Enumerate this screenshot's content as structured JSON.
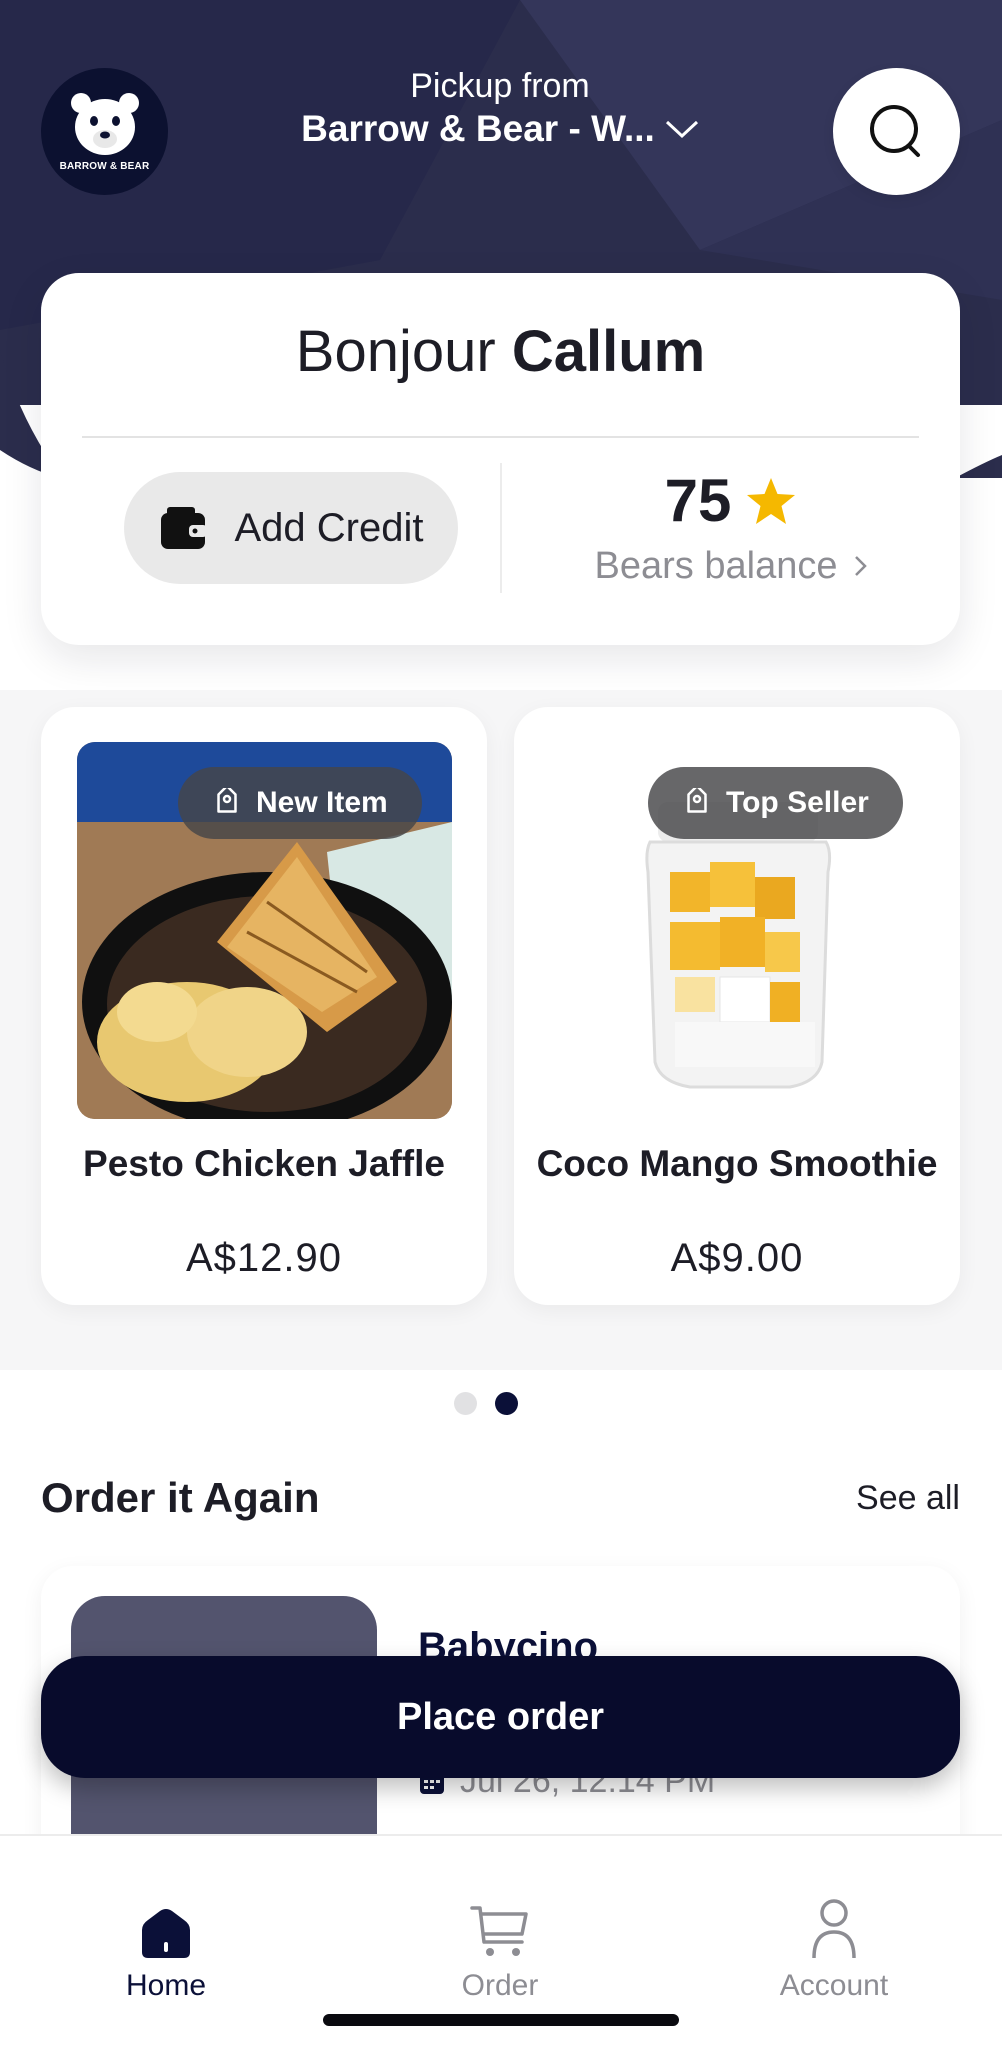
{
  "header": {
    "brand_logo_text": "BARROW & BEAR",
    "pickup_label": "Pickup from",
    "store_name": "Barrow & Bear - W..."
  },
  "greeting": {
    "prefix": "Bonjour",
    "name": "Callum"
  },
  "wallet": {
    "add_credit_label": "Add Credit",
    "bears_balance_value": "75",
    "bears_balance_label": "Bears balance"
  },
  "featured": [
    {
      "badge": "New Item",
      "name": "Pesto Chicken Jaffle",
      "price": "A$12.90"
    },
    {
      "badge": "Top Seller",
      "name": "Coco Mango Smoothie",
      "price": "A$9.00"
    }
  ],
  "carousel": {
    "pages": 2,
    "active_page": 2
  },
  "order_again": {
    "title": "Order it Again",
    "see_all_label": "See all",
    "items": [
      {
        "name": "Babycino",
        "date": "Jul 26, 12:14 PM"
      }
    ]
  },
  "place_order_label": "Place order",
  "tabbar": {
    "items": [
      {
        "label": "Home",
        "icon": "home-icon",
        "active": true
      },
      {
        "label": "Order",
        "icon": "cart-icon",
        "active": false
      },
      {
        "label": "Account",
        "icon": "person-icon",
        "active": false
      }
    ]
  },
  "colors": {
    "navy": "#080b2c",
    "hero_bg": "#2b2d4c",
    "star": "#f5b800",
    "muted_text": "#8d8d93"
  }
}
